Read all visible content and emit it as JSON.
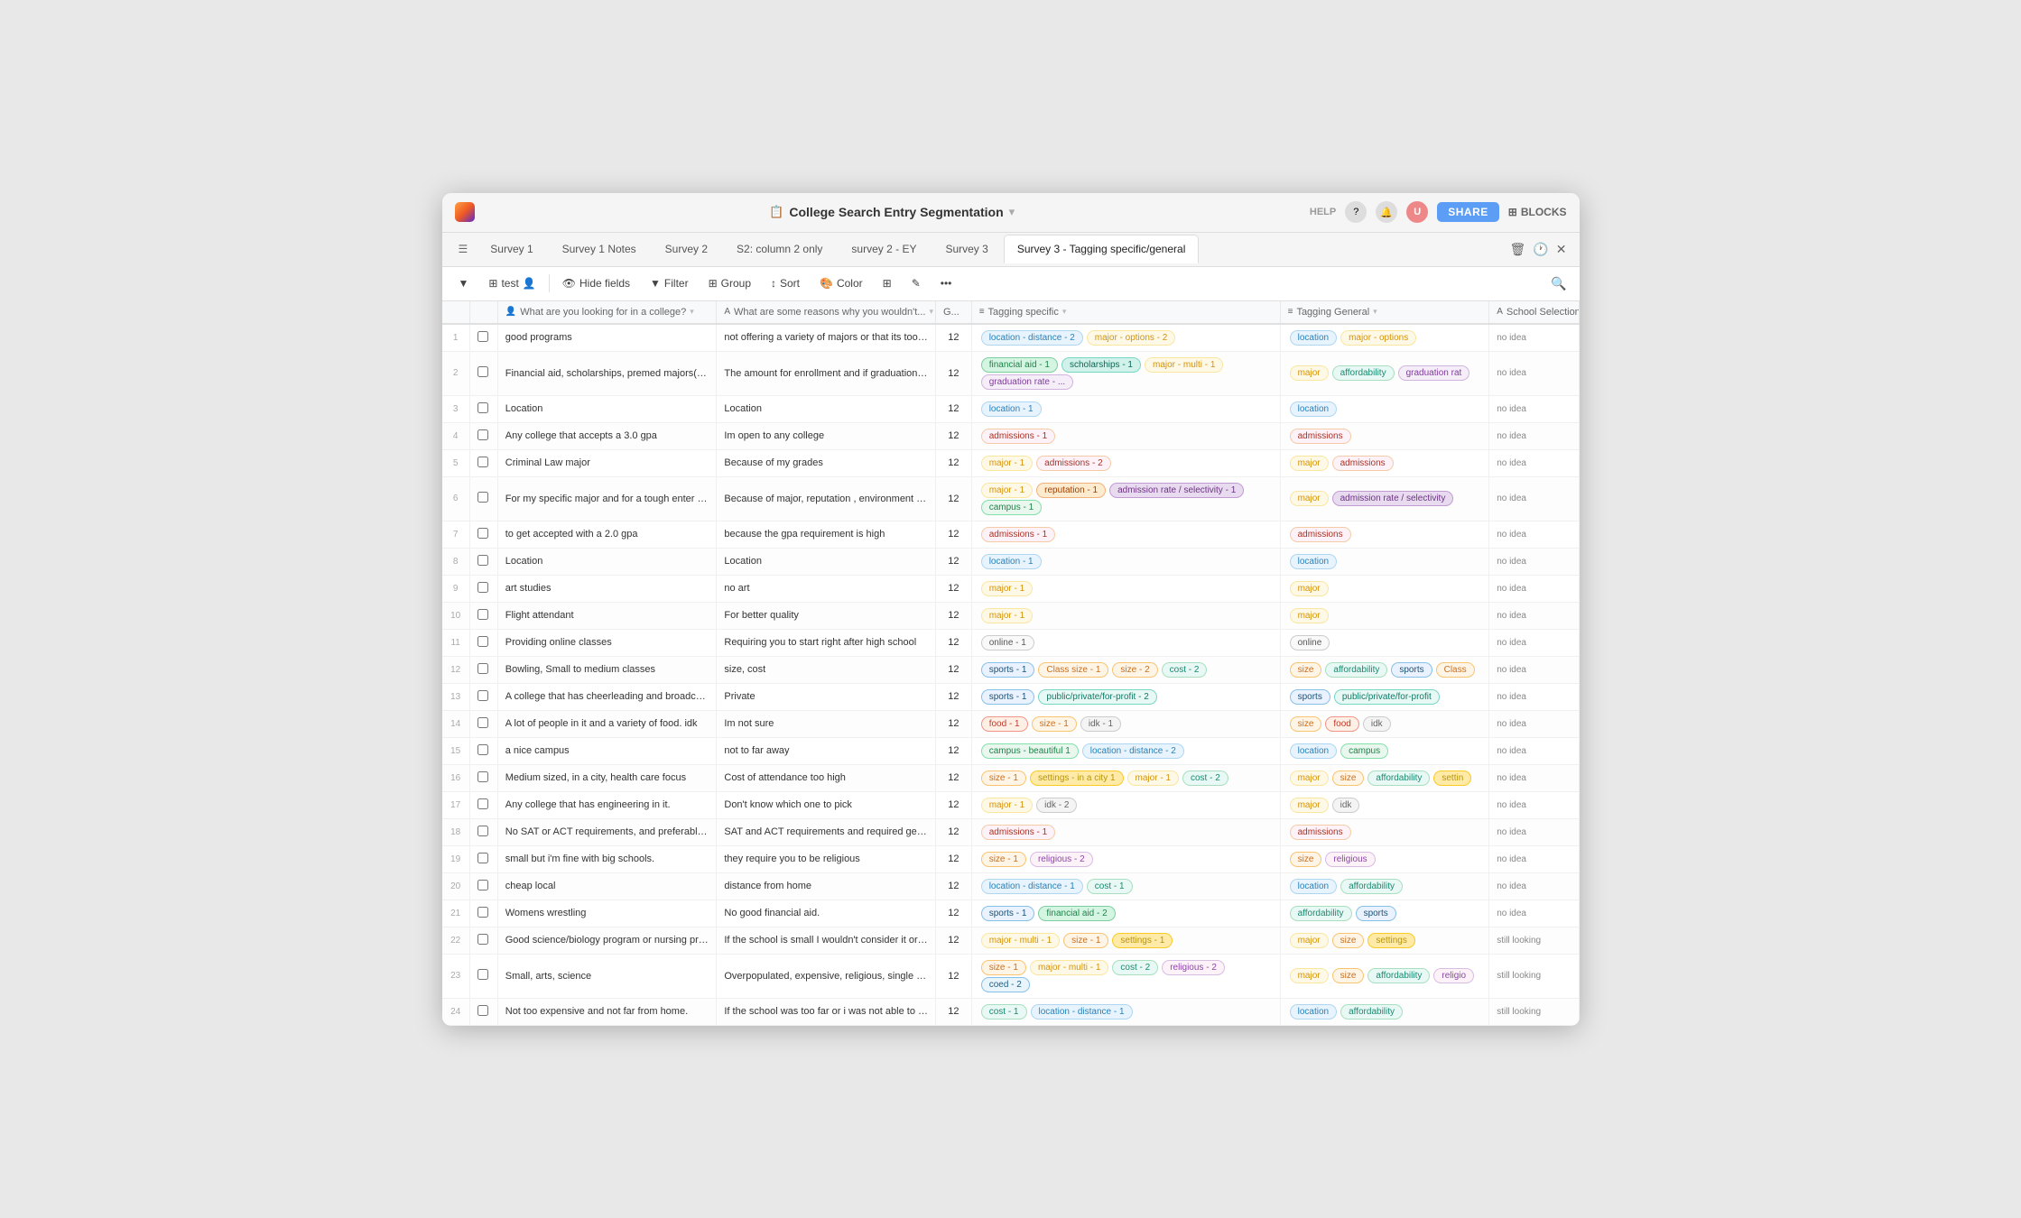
{
  "window": {
    "title": "College Search Entry Segmentation",
    "title_icon": "📋"
  },
  "titlebar": {
    "help_label": "HELP",
    "share_label": "SHARE",
    "blocks_label": "BLOCKS"
  },
  "tabs": [
    {
      "id": "survey1",
      "label": "Survey 1",
      "active": false
    },
    {
      "id": "survey1notes",
      "label": "Survey 1 Notes",
      "active": false
    },
    {
      "id": "survey2",
      "label": "Survey 2",
      "active": false
    },
    {
      "id": "s2col2only",
      "label": "S2: column 2 only",
      "active": false
    },
    {
      "id": "survey2ey",
      "label": "survey 2 - EY",
      "active": false
    },
    {
      "id": "survey3",
      "label": "Survey 3",
      "active": false
    },
    {
      "id": "survey3tagging",
      "label": "Survey 3 - Tagging specific/general",
      "active": true
    }
  ],
  "toolbar": {
    "table_icon": "⊞",
    "test_label": "test",
    "hide_fields_label": "Hide fields",
    "filter_label": "Filter",
    "group_label": "Group",
    "sort_label": "Sort",
    "color_label": "Color"
  },
  "columns": [
    {
      "id": "q1",
      "label": "What are you looking for in a college?",
      "icon": "👤"
    },
    {
      "id": "q2",
      "label": "What are some reasons why you wouldn't...",
      "icon": "A"
    },
    {
      "id": "size",
      "label": "G..."
    },
    {
      "id": "tag_specific",
      "label": "Tagging specific",
      "icon": "≡"
    },
    {
      "id": "tag_general",
      "label": "Tagging General",
      "icon": "≡"
    },
    {
      "id": "school",
      "label": "School Selection",
      "icon": "A"
    }
  ],
  "rows": [
    {
      "num": "1",
      "q1": "good programs",
      "q2": "not offering a variety of majors or that its too far",
      "size": "12",
      "tags_specific": [
        {
          "label": "location - distance - 2",
          "type": "location"
        },
        {
          "label": "major - options - 2",
          "type": "major"
        }
      ],
      "tags_general": [
        {
          "label": "location",
          "type": "location"
        },
        {
          "label": "major - options",
          "type": "major"
        }
      ],
      "school": "no idea"
    },
    {
      "num": "2",
      "q1": "Financial aid, scholarships, premed majors(biology) and psychology (so...",
      "q2": "The amount for enrollment and if graduation ra...",
      "size": "12",
      "tags_specific": [
        {
          "label": "financial aid - 1",
          "type": "financialaid"
        },
        {
          "label": "scholarships - 1",
          "type": "scholarships"
        },
        {
          "label": "major - multi - 1",
          "type": "major"
        },
        {
          "label": "graduation rate - ...",
          "type": "graduation"
        }
      ],
      "tags_general": [
        {
          "label": "major",
          "type": "major"
        },
        {
          "label": "affordability",
          "type": "affordability"
        },
        {
          "label": "graduation rat",
          "type": "graduation"
        }
      ],
      "school": "no idea"
    },
    {
      "num": "3",
      "q1": "Location",
      "q2": "Location",
      "size": "12",
      "tags_specific": [
        {
          "label": "location - 1",
          "type": "location"
        }
      ],
      "tags_general": [
        {
          "label": "location",
          "type": "location"
        }
      ],
      "school": "no idea"
    },
    {
      "num": "4",
      "q1": "Any college that accepts a 3.0 gpa",
      "q2": "Im open to any college",
      "size": "12",
      "tags_specific": [
        {
          "label": "admissions - 1",
          "type": "admissions"
        }
      ],
      "tags_general": [
        {
          "label": "admissions",
          "type": "admissions"
        }
      ],
      "school": "no idea"
    },
    {
      "num": "5",
      "q1": "Criminal Law major",
      "q2": "Because of my grades",
      "size": "12",
      "tags_specific": [
        {
          "label": "major - 1",
          "type": "major"
        },
        {
          "label": "admissions - 2",
          "type": "admissions"
        }
      ],
      "tags_general": [
        {
          "label": "major",
          "type": "major"
        },
        {
          "label": "admissions",
          "type": "admissions"
        }
      ],
      "school": "no idea"
    },
    {
      "num": "6",
      "q1": "For my specific major and for a tough enter meaning i need a college lik...",
      "q2": "Because of major, reputation , environment an...",
      "size": "12",
      "tags_specific": [
        {
          "label": "major - 1",
          "type": "major"
        },
        {
          "label": "reputation - 1",
          "type": "reputation"
        },
        {
          "label": "admission rate / selectivity - 1",
          "type": "admission-rate"
        },
        {
          "label": "campus - 1",
          "type": "campus"
        }
      ],
      "tags_general": [
        {
          "label": "major",
          "type": "major"
        },
        {
          "label": "admission rate / selectivity",
          "type": "admission-rate"
        }
      ],
      "school": "no idea"
    },
    {
      "num": "7",
      "q1": "to get accepted with a 2.0 gpa",
      "q2": "because the gpa requirement is high",
      "size": "12",
      "tags_specific": [
        {
          "label": "admissions - 1",
          "type": "admissions"
        }
      ],
      "tags_general": [
        {
          "label": "admissions",
          "type": "admissions"
        }
      ],
      "school": "no idea"
    },
    {
      "num": "8",
      "q1": "Location",
      "q2": "Location",
      "size": "12",
      "tags_specific": [
        {
          "label": "location - 1",
          "type": "location"
        }
      ],
      "tags_general": [
        {
          "label": "location",
          "type": "location"
        }
      ],
      "school": "no idea"
    },
    {
      "num": "9",
      "q1": "art studies",
      "q2": "no art",
      "size": "12",
      "tags_specific": [
        {
          "label": "major - 1",
          "type": "major"
        }
      ],
      "tags_general": [
        {
          "label": "major",
          "type": "major"
        }
      ],
      "school": "no idea"
    },
    {
      "num": "10",
      "q1": "Flight attendant",
      "q2": "For better quality",
      "size": "12",
      "tags_specific": [
        {
          "label": "major - 1",
          "type": "major"
        }
      ],
      "tags_general": [
        {
          "label": "major",
          "type": "major"
        }
      ],
      "school": "no idea"
    },
    {
      "num": "11",
      "q1": "Providing online classes",
      "q2": "Requiring you to start right after high school",
      "size": "12",
      "tags_specific": [
        {
          "label": "online - 1",
          "type": "online"
        }
      ],
      "tags_general": [
        {
          "label": "online",
          "type": "online"
        }
      ],
      "school": "no idea"
    },
    {
      "num": "12",
      "q1": "Bowling, Small to medium classes",
      "q2": "size, cost",
      "size": "12",
      "tags_specific": [
        {
          "label": "sports - 1",
          "type": "sports"
        },
        {
          "label": "Class size - 1",
          "type": "size"
        },
        {
          "label": "size - 2",
          "type": "size"
        },
        {
          "label": "cost - 2",
          "type": "affordability"
        }
      ],
      "tags_general": [
        {
          "label": "size",
          "type": "size"
        },
        {
          "label": "affordability",
          "type": "affordability"
        },
        {
          "label": "sports",
          "type": "sports"
        },
        {
          "label": "Class",
          "type": "size"
        }
      ],
      "school": "no idea"
    },
    {
      "num": "13",
      "q1": "A college that has cheerleading and broadcast journalism",
      "q2": "Private",
      "size": "12",
      "tags_specific": [
        {
          "label": "sports - 1",
          "type": "sports"
        },
        {
          "label": "public/private/for-profit - 2",
          "type": "public"
        }
      ],
      "tags_general": [
        {
          "label": "sports",
          "type": "sports"
        },
        {
          "label": "public/private/for-profit",
          "type": "public"
        }
      ],
      "school": "no idea"
    },
    {
      "num": "14",
      "q1": "A lot of people in it and a variety of food. idk",
      "q2": "Im not sure",
      "size": "12",
      "tags_specific": [
        {
          "label": "food - 1",
          "type": "food"
        },
        {
          "label": "size - 1",
          "type": "size"
        },
        {
          "label": "idk - 1",
          "type": "idk"
        }
      ],
      "tags_general": [
        {
          "label": "size",
          "type": "size"
        },
        {
          "label": "food",
          "type": "food"
        },
        {
          "label": "idk",
          "type": "idk"
        }
      ],
      "school": "no idea"
    },
    {
      "num": "15",
      "q1": "a nice campus",
      "q2": "not to far away",
      "size": "12",
      "tags_specific": [
        {
          "label": "campus - beautiful 1",
          "type": "campus"
        },
        {
          "label": "location - distance - 2",
          "type": "location"
        }
      ],
      "tags_general": [
        {
          "label": "location",
          "type": "location"
        },
        {
          "label": "campus",
          "type": "campus"
        }
      ],
      "school": "no idea"
    },
    {
      "num": "16",
      "q1": "Medium sized, in a city, health care focus",
      "q2": "Cost of attendance too high",
      "size": "12",
      "tags_specific": [
        {
          "label": "size - 1",
          "type": "size"
        },
        {
          "label": "settings - in a city 1",
          "type": "settings"
        },
        {
          "label": "major - 1",
          "type": "major"
        },
        {
          "label": "cost - 2",
          "type": "affordability"
        }
      ],
      "tags_general": [
        {
          "label": "major",
          "type": "major"
        },
        {
          "label": "size",
          "type": "size"
        },
        {
          "label": "affordability",
          "type": "affordability"
        },
        {
          "label": "settin",
          "type": "settings"
        }
      ],
      "school": "no idea"
    },
    {
      "num": "17",
      "q1": "Any college that has engineering in it.",
      "q2": "Don't know which one to pick",
      "size": "12",
      "tags_specific": [
        {
          "label": "major - 1",
          "type": "major"
        },
        {
          "label": "idk - 2",
          "type": "idk"
        }
      ],
      "tags_general": [
        {
          "label": "major",
          "type": "major"
        },
        {
          "label": "idk",
          "type": "idk"
        }
      ],
      "school": "no idea"
    },
    {
      "num": "18",
      "q1": "No SAT or ACT requirements, and preferably no requiredgeneral educat...",
      "q2": "SAT and ACT requirements and required gener...",
      "size": "12",
      "tags_specific": [
        {
          "label": "admissions - 1",
          "type": "admissions"
        }
      ],
      "tags_general": [
        {
          "label": "admissions",
          "type": "admissions"
        }
      ],
      "school": "no idea"
    },
    {
      "num": "19",
      "q1": "small but i'm fine with big schools.",
      "q2": "they require you to be religious",
      "size": "12",
      "tags_specific": [
        {
          "label": "size - 1",
          "type": "size"
        },
        {
          "label": "religious - 2",
          "type": "religious"
        }
      ],
      "tags_general": [
        {
          "label": "size",
          "type": "size"
        },
        {
          "label": "religious",
          "type": "religious"
        }
      ],
      "school": "no idea"
    },
    {
      "num": "20",
      "q1": "cheap local",
      "q2": "distance from home",
      "size": "12",
      "tags_specific": [
        {
          "label": "location - distance - 1",
          "type": "location"
        },
        {
          "label": "cost - 1",
          "type": "affordability"
        }
      ],
      "tags_general": [
        {
          "label": "location",
          "type": "location"
        },
        {
          "label": "affordability",
          "type": "affordability"
        }
      ],
      "school": "no idea"
    },
    {
      "num": "21",
      "q1": "Womens wrestling",
      "q2": "No good financial aid.",
      "size": "12",
      "tags_specific": [
        {
          "label": "sports - 1",
          "type": "sports"
        },
        {
          "label": "financial aid - 2",
          "type": "financialaid"
        }
      ],
      "tags_general": [
        {
          "label": "affordability",
          "type": "affordability"
        },
        {
          "label": "sports",
          "type": "sports"
        }
      ],
      "school": "no idea"
    },
    {
      "num": "22",
      "q1": "Good science/biology program or nursing program, good campus mean...",
      "q2": "If the school is small I wouldn't consider it or d...",
      "size": "12",
      "tags_specific": [
        {
          "label": "major - multi - 1",
          "type": "major"
        },
        {
          "label": "size - 1",
          "type": "size"
        },
        {
          "label": "settings - 1",
          "type": "settings"
        }
      ],
      "tags_general": [
        {
          "label": "major",
          "type": "major"
        },
        {
          "label": "size",
          "type": "size"
        },
        {
          "label": "settings",
          "type": "settings"
        }
      ],
      "school": "still looking"
    },
    {
      "num": "23",
      "q1": "Small, arts, science",
      "q2": "Overpopulated, expensive, religious, single ge...",
      "size": "12",
      "tags_specific": [
        {
          "label": "size - 1",
          "type": "size"
        },
        {
          "label": "major - multi - 1",
          "type": "major"
        },
        {
          "label": "cost - 2",
          "type": "affordability"
        },
        {
          "label": "religious - 2",
          "type": "religious"
        },
        {
          "label": "coed - 2",
          "type": "coed"
        }
      ],
      "tags_general": [
        {
          "label": "major",
          "type": "major"
        },
        {
          "label": "size",
          "type": "size"
        },
        {
          "label": "affordability",
          "type": "affordability"
        },
        {
          "label": "religio",
          "type": "religious"
        }
      ],
      "school": "still looking"
    },
    {
      "num": "24",
      "q1": "Not too expensive and not far from home.",
      "q2": "If the school was too far or i was not able to aff...",
      "size": "12",
      "tags_specific": [
        {
          "label": "cost - 1",
          "type": "affordability"
        },
        {
          "label": "location - distance - 1",
          "type": "location"
        }
      ],
      "tags_general": [
        {
          "label": "location",
          "type": "location"
        },
        {
          "label": "affordability",
          "type": "affordability"
        }
      ],
      "school": "still looking"
    }
  ]
}
